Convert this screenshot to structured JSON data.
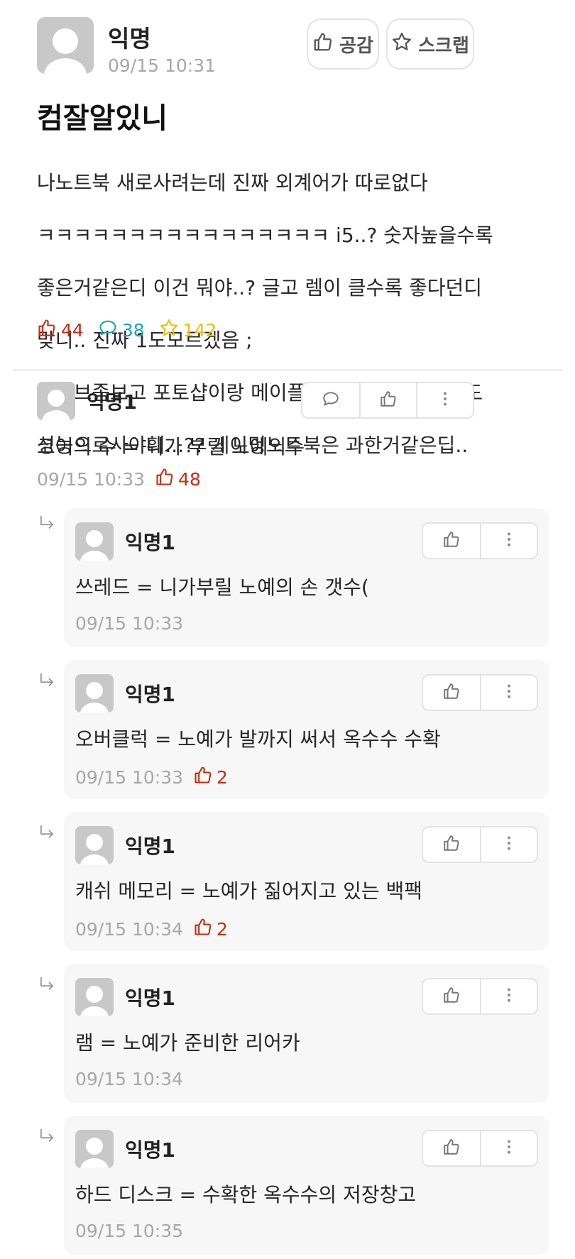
{
  "post": {
    "author": "익명",
    "time": "09/15 10:31",
    "empathy_label": "공감",
    "scrap_label": "스크랩",
    "title": "컴잘알있니",
    "body_lines": [
      "나노트북 새로사려는데 진짜 외계어가 따로없다",
      "ㅋㅋㅋㅋㅋㅋㅋㅋㅋㅋㅋㅋㅋㅋㅋㅋ i5..? 숫자높을수록",
      "좋은거같은디 이건 뭐야..? 글고 렘이 클수록 좋다던디",
      "맞니.. 진짜 1도모르겠음 ;",
      "유튜브좀보고 포토샵이랑 메이플 자주할건디 어느정도",
      "성능으로사야훼...?? 게이밍노트북은 과한거같은딥.."
    ],
    "stats": {
      "likes": "44",
      "comments": "38",
      "scraps": "142"
    }
  },
  "comment": {
    "author": "익명1",
    "text": "코어의 수 = 니가 부릴 노예의수",
    "time": "09/15 10:33",
    "likes": "48"
  },
  "replies": [
    {
      "author": "익명1",
      "text": "쓰레드 = 니가부릴 노예의 손 갯수(",
      "time": "09/15 10:33",
      "likes": ""
    },
    {
      "author": "익명1",
      "text": "오버클럭 = 노예가 발까지 써서 옥수수 수확",
      "time": "09/15 10:33",
      "likes": "2"
    },
    {
      "author": "익명1",
      "text": "캐쉬 메모리 = 노예가 짊어지고 있는 백팩",
      "time": "09/15 10:34",
      "likes": "2"
    },
    {
      "author": "익명1",
      "text": "램 = 노예가 준비한 리어카",
      "time": "09/15 10:34",
      "likes": ""
    },
    {
      "author": "익명1",
      "text": "하드 디스크 = 수확한 옥수수의 저장창고",
      "time": "09/15 10:35",
      "likes": ""
    }
  ],
  "colors": {
    "like_red": "#c62d12",
    "comment_teal": "#1aa7b3",
    "scrap_yellow": "#f0c000",
    "reply_bg": "#f7f7f7"
  },
  "icons": {
    "like": "thumbs-up-icon",
    "comment": "speech-bubble-icon",
    "scrap": "star-icon",
    "more": "more-vertical-icon",
    "reply": "reply-arrow-icon"
  }
}
